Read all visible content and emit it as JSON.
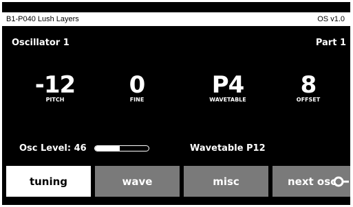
{
  "title_bar": {
    "preset": "B1-P040 Lush Layers",
    "version": "OS v1.0"
  },
  "header": {
    "section": "Oscillator 1",
    "part": "Part 1"
  },
  "params": [
    {
      "value": "-12",
      "label": "PITCH"
    },
    {
      "value": "0",
      "label": "FINE"
    },
    {
      "value": "P4",
      "label": "WAVETABLE"
    },
    {
      "value": "8",
      "label": "OFFSET"
    }
  ],
  "osc_level": {
    "text": "Osc Level: 46",
    "level_fraction": 0.46
  },
  "wavetable_text": "Wavetable P12",
  "buttons": [
    {
      "label": "tuning",
      "active": true
    },
    {
      "label": "wave",
      "active": false
    },
    {
      "label": "misc",
      "active": false
    },
    {
      "label": "next osc",
      "active": false
    }
  ],
  "colors": {
    "background": "#000000",
    "foreground": "#ffffff",
    "button_inactive": "#7a7a7a"
  },
  "icons": {
    "next_osc": "encoder-knob-icon"
  }
}
